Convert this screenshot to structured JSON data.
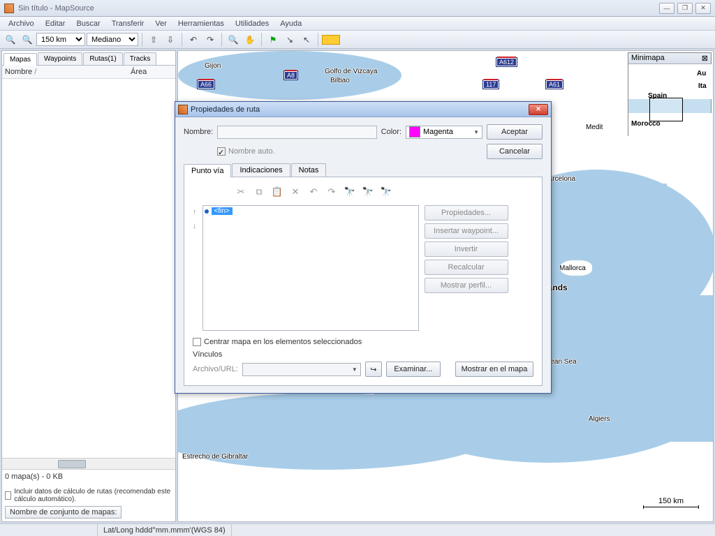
{
  "window": {
    "title": "Sin título - MapSource"
  },
  "menu": {
    "archivo": "Archivo",
    "editar": "Editar",
    "buscar": "Buscar",
    "transferir": "Transferir",
    "ver": "Ver",
    "herramientas": "Herramientas",
    "utilidades": "Utilidades",
    "ayuda": "Ayuda"
  },
  "toolbar": {
    "scale": "150 km",
    "detail": "Mediano"
  },
  "side": {
    "tabs": {
      "mapas": "Mapas",
      "waypoints": "Waypoints",
      "rutas": "Rutas(1)",
      "tracks": "Tracks"
    },
    "cols": {
      "nombre": "Nombre",
      "area": "Área",
      "sort": "/"
    },
    "status": "0 mapa(s) - 0 KB",
    "chk": "Incluir datos de cálculo de rutas (recomendab este cálculo automático).",
    "btn": "Nombre de conjunto de mapas:"
  },
  "map": {
    "minimap_title": "Minimapa",
    "roads": {
      "a66": "A66",
      "a8": "A8",
      "a612": "A612",
      "r117": "117",
      "a61": "A61"
    },
    "labels": {
      "gijon": "Gijon",
      "golfo": "Golfo de Vizcaya",
      "bilbao": "Bilbao",
      "barcelona": "Barcelona",
      "mallorca": "Mallorca",
      "islands": "ic Islands",
      "medit": "Medit",
      "sea": "erranean Sea",
      "algiers": "Algiers",
      "gibraltar": "Estrecho de Gibraltar",
      "spain": "Spain",
      "morocco": "Morocco",
      "au": "Au",
      "ita": "Ita"
    },
    "scale": "150 km"
  },
  "dialog": {
    "title": "Propiedades de ruta",
    "nombre": "Nombre:",
    "nombre_auto": "Nombre auto.",
    "color_lbl": "Color:",
    "color_name": "Magenta",
    "aceptar": "Aceptar",
    "cancelar": "Cancelar",
    "tabs": {
      "punto": "Punto vía",
      "indic": "Indicaciones",
      "notas": "Notas"
    },
    "fin": "<fin>",
    "btns": {
      "prop": "Propiedades...",
      "ins": "Insertar waypoint...",
      "inv": "Invertir",
      "rec": "Recalcular",
      "perf": "Mostrar perfil..."
    },
    "centrar": "Centrar mapa en los elementos seleccionados",
    "vinculos": "Vínculos",
    "archivo": "Archivo/URL:",
    "examinar": "Examinar...",
    "mostrar": "Mostrar en el mapa"
  },
  "status": {
    "coord": "Lat/Long hddd°mm.mmm'(WGS 84)"
  }
}
